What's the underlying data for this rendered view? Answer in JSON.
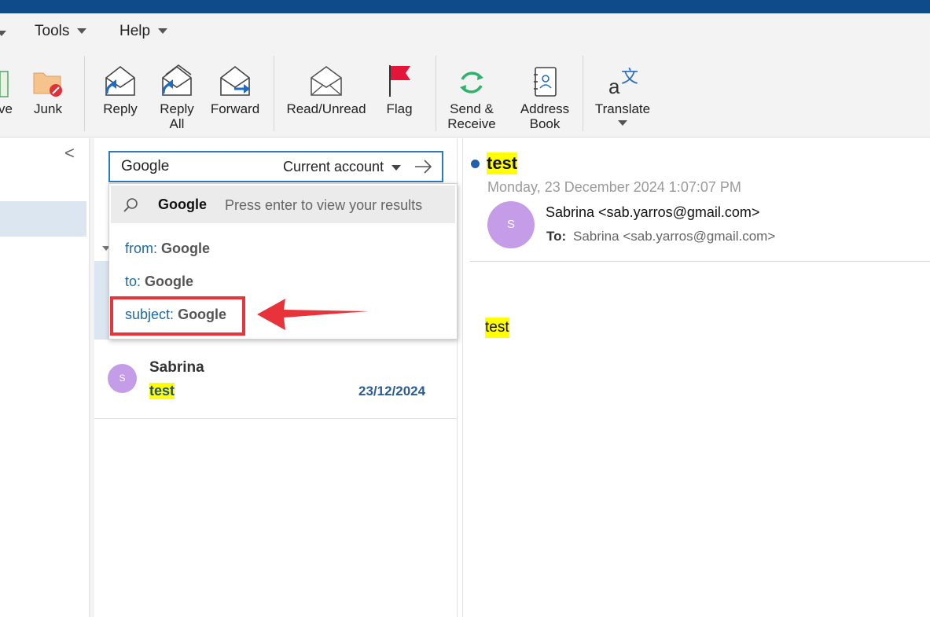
{
  "colors": {
    "titlebar": "#0f4b8a",
    "accent": "#2b79c2",
    "highlight": "#ffff00",
    "avatar": "#c59ce8",
    "annotation": "#e8333a"
  },
  "menu": {
    "tools": "Tools",
    "help": "Help"
  },
  "ribbon": {
    "archive_partial": "ve",
    "junk": "Junk",
    "reply": "Reply",
    "reply_all_line1": "Reply",
    "reply_all_line2": "All",
    "forward": "Forward",
    "read_unread": "Read/Unread",
    "flag": "Flag",
    "send_receive_line1": "Send &",
    "send_receive_line2": "Receive",
    "address_book_line1": "Address",
    "address_book_line2": "Book",
    "translate": "Translate"
  },
  "search": {
    "value": "Google",
    "scope": "Current account"
  },
  "suggestions": {
    "term": "Google",
    "hint": "Press enter to view your results",
    "options": [
      {
        "prefix": "from:",
        "term": "Google"
      },
      {
        "prefix": "to:",
        "term": "Google"
      },
      {
        "prefix": "subject:",
        "term": "Google"
      }
    ]
  },
  "message_list": {
    "items": [
      {
        "avatar": "S",
        "sender": "Sabrina",
        "subject": "test",
        "date": "23/12/2024"
      }
    ]
  },
  "reading_pane": {
    "subject": "test",
    "date": "Monday, 23 December 2024 1:07:07 PM",
    "avatar": "S",
    "from": "Sabrina <sab.yarros@gmail.com>",
    "to_label": "To:",
    "to": "Sabrina <sab.yarros@gmail.com>",
    "body": "test"
  }
}
